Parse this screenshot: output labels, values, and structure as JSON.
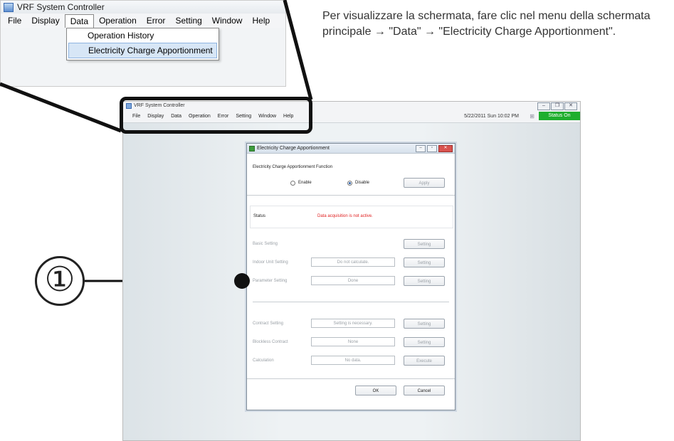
{
  "zoom": {
    "app_title": "VRF System Controller",
    "menus": [
      "File",
      "Display",
      "Data",
      "Operation",
      "Error",
      "Setting",
      "Window",
      "Help"
    ],
    "open_menu": "Data",
    "dropdown_items": [
      "Operation History",
      "Electricity Charge Apportionment"
    ],
    "highlighted_item": "Electricity Charge Apportionment"
  },
  "instruction": "Per visualizzare la schermata, fare clic nel menu della schermata principale → \"Data\" → \"Electricity Charge Apportionment\".",
  "screen": {
    "app_title": "VRF System Controller",
    "menus": [
      "File",
      "Display",
      "Data",
      "Operation",
      "Error",
      "Setting",
      "Window",
      "Help"
    ],
    "datetime": "5/22/2011 Sun 10:02 PM",
    "status": "Status On",
    "status_color": "#1fae2e"
  },
  "dialog": {
    "title": "Electricity Charge Apportionment",
    "function_label": "Electricity Charge Apportionment Function",
    "enable_label": "Enable",
    "disable_label": "Disable",
    "selected_option": "Disable",
    "apply_label": "Apply",
    "status_label": "Status",
    "status_text": "Data acquisition is not active.",
    "status_text_color": "#e02020",
    "rows": [
      {
        "label": "Basic Setting",
        "value": "",
        "button": "Setting"
      },
      {
        "label": "Indoor Unit Setting",
        "value": "Do not calculate.",
        "button": "Setting"
      },
      {
        "label": "Parameter Setting",
        "value": "Done",
        "button": "Setting"
      },
      {
        "label": "Contract Setting",
        "value": "Setting is necessary.",
        "button": "Setting"
      },
      {
        "label": "Blockless Contract",
        "value": "None",
        "button": "Setting"
      },
      {
        "label": "Calculation",
        "value": "No data.",
        "button": "Execute"
      }
    ],
    "ok_label": "OK",
    "cancel_label": "Cancel"
  },
  "callout": {
    "number": "①"
  }
}
